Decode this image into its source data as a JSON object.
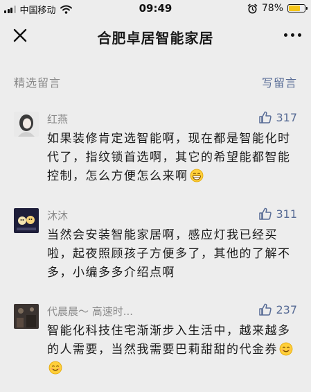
{
  "status_bar": {
    "carrier": "中国移动",
    "time": "09:49",
    "battery_percent": "78%",
    "battery_level": 0.78
  },
  "nav": {
    "title": "合肥卓居智能家居",
    "close_icon": "close-icon",
    "more_icon": "more-dots-icon"
  },
  "section": {
    "title": "精选留言",
    "write_label": "写留言"
  },
  "comments": [
    {
      "author": "红燕",
      "likes": "317",
      "text": "如果装修肯定选智能啊，现在都是智能化时代了，指纹锁首选啊，其它的希望能都智能控制，怎么方便怎么来啊",
      "emojis": [
        "grin-emoji"
      ]
    },
    {
      "author": "沐沐",
      "likes": "311",
      "text": "当然会安装智能家居啊，感应灯我已经买啦，起夜照顾孩子方便多了，其他的了解不多，小编多多介绍点啊",
      "emojis": []
    },
    {
      "author": "代晨晨～ 高速时...",
      "likes": "237",
      "text": "智能化科技住宅渐渐步入生活中，越来越多的人需要，当然我需要巴莉甜甜的代金券",
      "emojis": [
        "smile-emoji",
        "smile-emoji"
      ]
    }
  ],
  "colors": {
    "background": "#ededed",
    "link": "#576b95",
    "muted": "#8a8a8a",
    "battery": "#f5c518"
  }
}
